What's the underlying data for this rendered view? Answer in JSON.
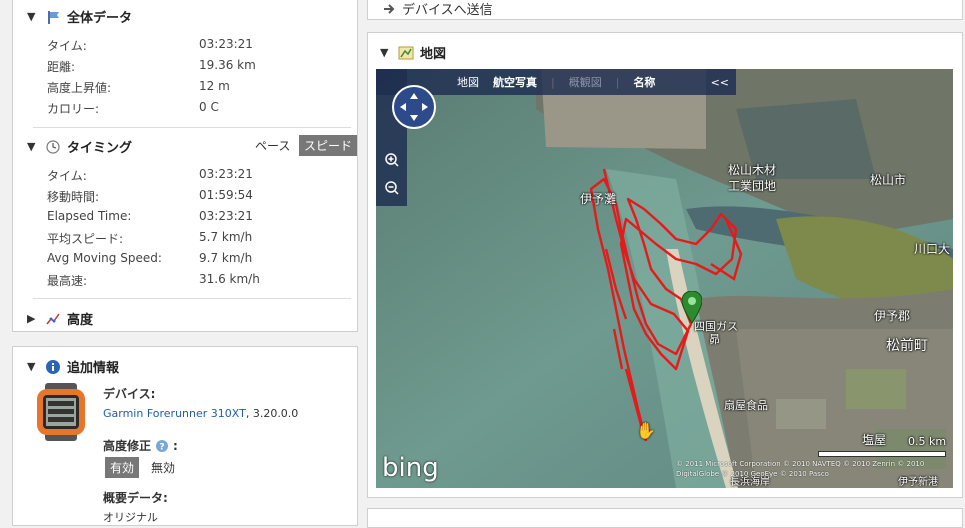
{
  "summary": {
    "title": "全体データ",
    "rows": [
      {
        "label": "タイム:",
        "value": "03:23:21"
      },
      {
        "label": "距離:",
        "value": "19.36 km"
      },
      {
        "label": "高度上昇値:",
        "value": "12 m"
      },
      {
        "label": "カロリー:",
        "value": "0 C"
      }
    ]
  },
  "timing": {
    "title": "タイミング",
    "pace_label": "ペース",
    "speed_label": "スピード",
    "rows": [
      {
        "label": "タイム:",
        "value": "03:23:21"
      },
      {
        "label": "移動時間:",
        "value": "01:59:54"
      },
      {
        "label": "Elapsed Time:",
        "value": "03:23:21"
      },
      {
        "label": "平均スピード:",
        "value": "5.7 km/h"
      },
      {
        "label": "Avg Moving Speed:",
        "value": "9.7 km/h"
      },
      {
        "label": "最高速:",
        "value": "31.6 km/h"
      }
    ]
  },
  "elevation": {
    "title": "高度"
  },
  "extra": {
    "title": "追加情報",
    "device_label": "デバイス:",
    "device_link": "Garmin Forerunner 310XT",
    "device_version": ", 3.20.0.0",
    "elev_fix_label": "高度修正",
    "elev_fix_colon": ":",
    "on_label": "有効",
    "off_label": "無効",
    "overview_label": "概要データ:",
    "overview_partial": "オリジナル"
  },
  "send": {
    "label": "デバイスへ送信"
  },
  "map_section": {
    "title": "地図",
    "toolbar": [
      "地図",
      "航空写真",
      "概観図",
      "名称",
      "<<"
    ],
    "places": [
      {
        "name": "松山木材"
      },
      {
        "name": "工業団地"
      },
      {
        "name": "松山市"
      },
      {
        "name": "伊予灘"
      },
      {
        "name": "川口大"
      },
      {
        "name": "伊予郡"
      },
      {
        "name": "松前町"
      },
      {
        "name": "四国ガス"
      },
      {
        "name": "昴"
      },
      {
        "name": "扇屋食品"
      },
      {
        "name": "塩屋"
      },
      {
        "name": "長浜海岸"
      },
      {
        "name": "伊予新港"
      }
    ],
    "scale_text": "0.5 km",
    "copyright": "© 2011 Microsoft Corporation  © 2010 NAVTEQ  © 2010 Zenrin  © 2010 DigitalGlobe  © 2010 GeoEye  © 2010 Pasco",
    "brand": "bing"
  },
  "colors": {
    "route": "#e31b1b",
    "selected": "#777777",
    "link": "#1f5fa8"
  }
}
